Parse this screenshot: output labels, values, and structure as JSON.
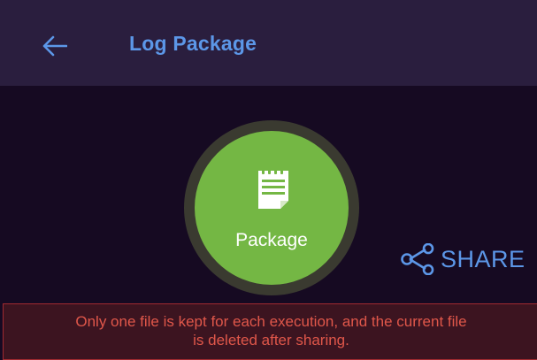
{
  "header": {
    "title": "Log Package",
    "back_icon": "arrow-left-icon"
  },
  "main": {
    "package_button": {
      "label": "Package",
      "icon": "notepad-icon",
      "color": "#74b744"
    },
    "share_button": {
      "label": "SHARE",
      "icon": "share-icon"
    }
  },
  "notice": {
    "line1": "Only one file is kept for each execution, and the current file",
    "line2": "is deleted after sharing."
  },
  "colors": {
    "accent": "#5c97e8",
    "header_bg": "#2a1e3e",
    "page_bg": "#160a22",
    "warning_text": "#e0574a"
  }
}
